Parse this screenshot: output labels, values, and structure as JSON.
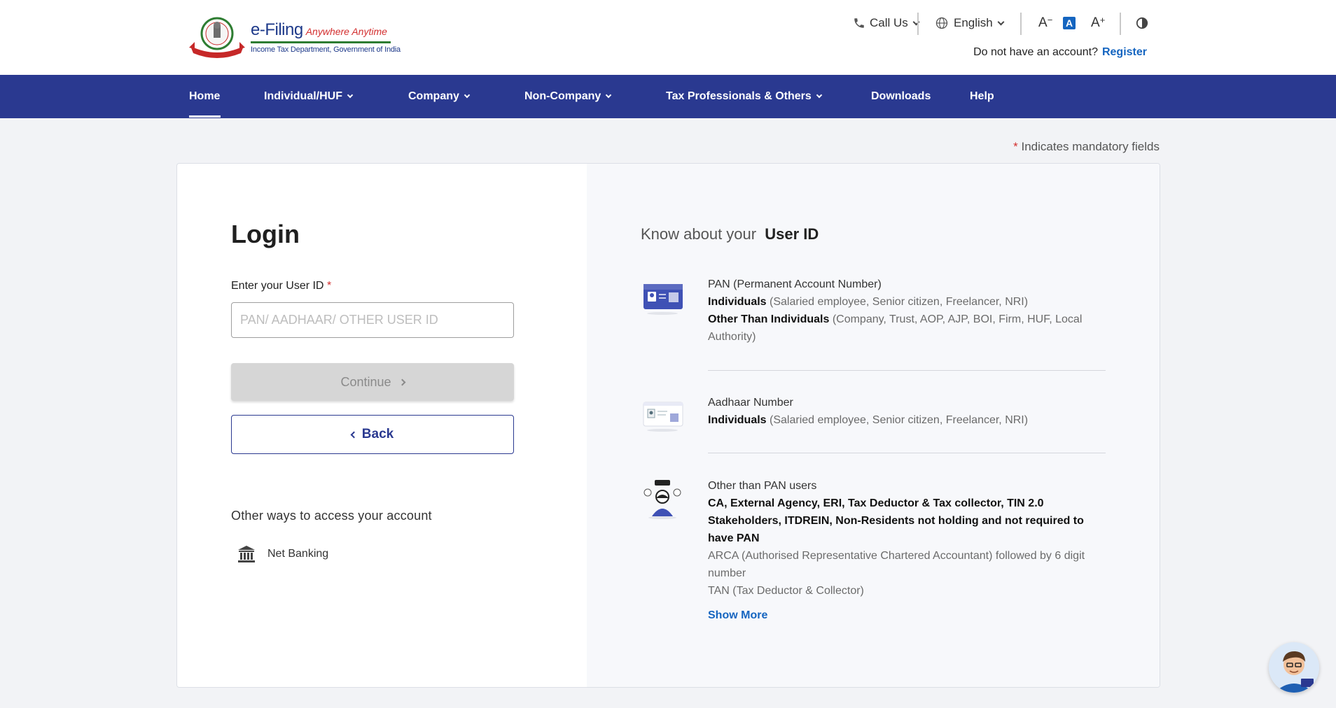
{
  "header": {
    "brand_title": "e-Filing",
    "brand_tagline": "Anywhere Anytime",
    "brand_subtitle": "Income Tax Department, Government of India",
    "call_us": "Call Us",
    "language": "English",
    "font_decrease": "A",
    "font_default": "A",
    "font_increase": "A",
    "account_prompt": "Do not have an account?",
    "register_link": "Register"
  },
  "nav": {
    "items": [
      {
        "label": "Home",
        "active": true,
        "dropdown": false
      },
      {
        "label": "Individual/HUF",
        "dropdown": true
      },
      {
        "label": "Company",
        "dropdown": true
      },
      {
        "label": "Non-Company",
        "dropdown": true
      },
      {
        "label": "Tax Professionals & Others",
        "dropdown": true
      },
      {
        "label": "Downloads",
        "dropdown": false
      },
      {
        "label": "Help",
        "dropdown": false
      }
    ]
  },
  "mandatory_note": "Indicates mandatory fields",
  "login": {
    "title": "Login",
    "userid_label": "Enter your User ID",
    "userid_placeholder": "PAN/ AADHAAR/ OTHER USER ID",
    "userid_value": "",
    "continue_label": "Continue",
    "back_label": "Back",
    "other_ways_title": "Other ways to access your account",
    "net_banking_label": "Net Banking"
  },
  "know": {
    "title_prefix": "Know about your",
    "title_strong": "User ID",
    "pan": {
      "heading": "PAN (Permanent Account Number)",
      "ind_label": "Individuals",
      "ind_desc": "(Salaried employee, Senior citizen, Freelancer, NRI)",
      "other_label": "Other Than Individuals",
      "other_desc": "(Company, Trust, AOP, AJP, BOI, Firm, HUF, Local Authority)"
    },
    "aadhaar": {
      "heading": "Aadhaar Number",
      "ind_label": "Individuals",
      "ind_desc": "(Salaried employee, Senior citizen, Freelancer, NRI)"
    },
    "other": {
      "heading": "Other than PAN users",
      "bold_desc": "CA, External Agency, ERI, Tax Deductor & Tax collector, TIN 2.0 Stakeholders, ITDREIN, Non-Residents not holding and not required to have PAN",
      "arca": "ARCA (Authorised Representative Chartered Accountant) followed by 6 digit number",
      "tan": "TAN (Tax Deductor & Collector)",
      "show_more": "Show More"
    }
  },
  "colors": {
    "nav_bg": "#2a3990",
    "link": "#1565c0",
    "required": "#d32f2f",
    "disabled_btn": "#d6d6d6"
  }
}
